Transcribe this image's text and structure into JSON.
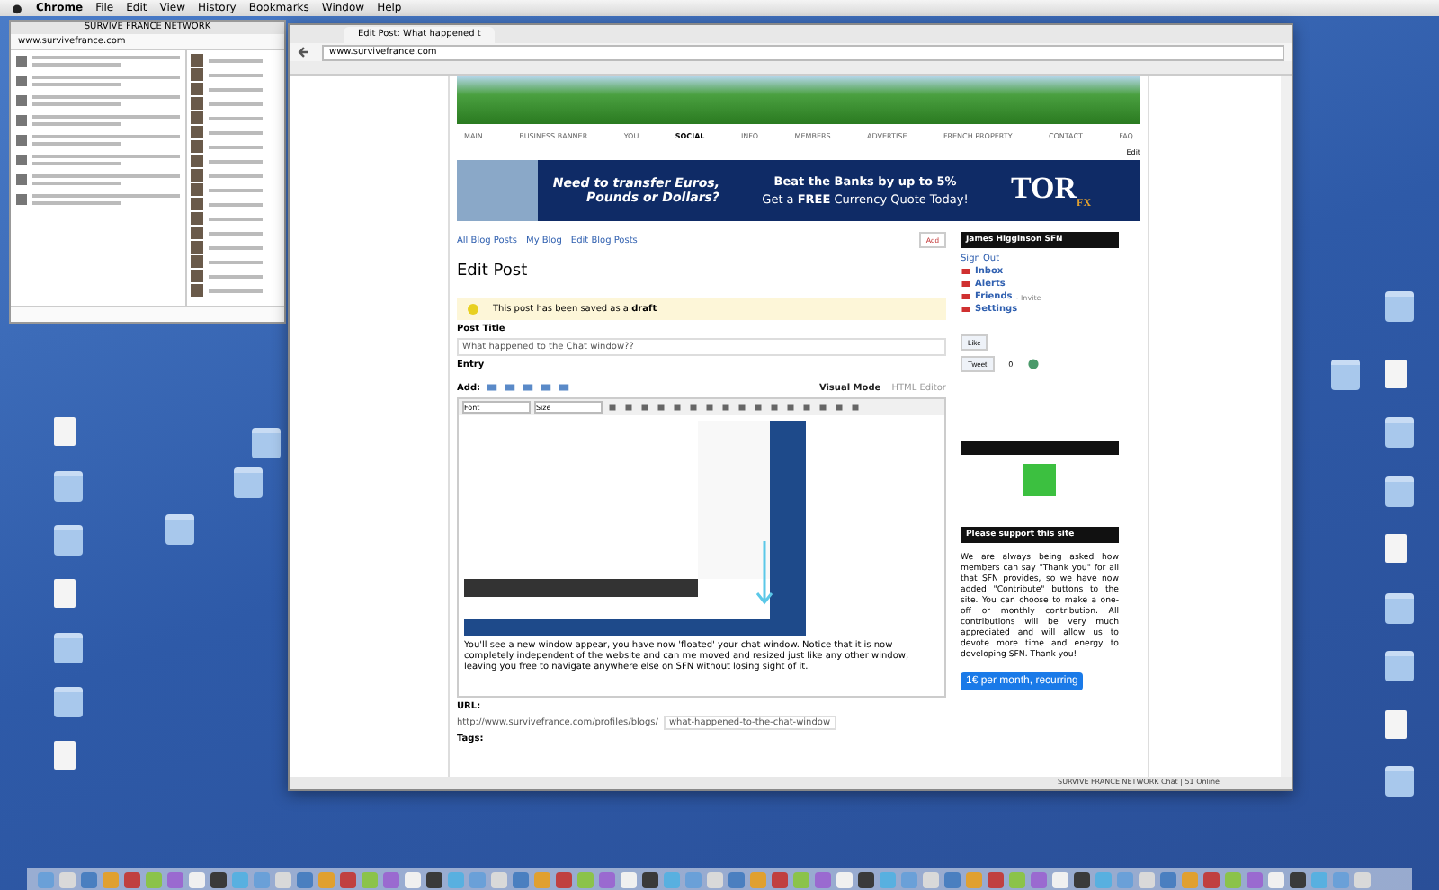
{
  "menubar": {
    "items": [
      "Chrome",
      "File",
      "Edit",
      "View",
      "History",
      "Bookmarks",
      "Window",
      "Help"
    ]
  },
  "chat_window": {
    "title": "SURVIVE FRANCE NETWORK",
    "url": "www.survivefrance.com"
  },
  "browser": {
    "tab_title": "Edit Post: What happened t",
    "url": "www.survivefrance.com",
    "nav": [
      {
        "label": "MAIN",
        "selected": false
      },
      {
        "label": "BUSINESS BANNER",
        "selected": false
      },
      {
        "label": "YOU",
        "selected": false
      },
      {
        "label": "SOCIAL",
        "selected": true
      },
      {
        "label": "INFO",
        "selected": false
      },
      {
        "label": "MEMBERS",
        "selected": false
      },
      {
        "label": "ADVERTISE",
        "selected": false
      },
      {
        "label": "FRENCH PROPERTY",
        "selected": false
      },
      {
        "label": "CONTACT",
        "selected": false
      },
      {
        "label": "FAQ",
        "selected": false
      }
    ],
    "edit_link": "Edit",
    "ad": {
      "left": "Need to transfer Euros, Pounds or Dollars?",
      "right_1": "Beat the Banks by up to 5%",
      "right_2": "Get a **FREE** Currency Quote Today!",
      "logo": "TOR",
      "logo_sub": "FX"
    },
    "blog_links": [
      "All Blog Posts",
      "My Blog",
      "Edit Blog Posts"
    ],
    "add_button": "Add",
    "heading": "Edit Post",
    "notice": "This post has been saved as a **draft**",
    "post_title_label": "Post Title",
    "post_title_value": "What happened to the Chat window??",
    "entry_label": "Entry",
    "add_label": "Add:",
    "editor_modes": [
      {
        "label": "Visual Mode",
        "selected": true
      },
      {
        "label": "HTML Editor",
        "selected": false
      }
    ],
    "font_select": "Font",
    "size_select": "Size",
    "entry_text": "You'll see a new window appear, you have now 'floated' your chat window. Notice that it is now completely independent of the website and can me moved and resized just like any other window, leaving you free to navigate anywhere else on SFN without losing sight of it.",
    "url_label": "URL:",
    "url_prefix": "http://www.survivefrance.com/profiles/blogs/",
    "url_slug": "what-happened-to-the-chat-window",
    "tags_label": "Tags:",
    "sidebar": {
      "user": "James Higginson SFN",
      "sign_out": "Sign Out",
      "items": [
        {
          "label": "Inbox"
        },
        {
          "label": "Alerts"
        },
        {
          "label": "Friends",
          "note": "- Invite"
        },
        {
          "label": "Settings"
        }
      ],
      "like": "Like",
      "tweet": "Tweet",
      "tweet_count": "0",
      "support_title": "Please support this site",
      "support_text": "We are always being asked how members can say \"Thank you\" for all that SFN provides, so we have now added \"Contribute\" buttons to the site. You can choose to make a one-off or monthly contribution. All contributions will be very much appreciated and will allow us to devote more time and energy to developing SFN. Thank you!",
      "contribute": "1€ per month, recurring"
    },
    "status_right": "SURVIVE FRANCE NETWORK Chat | 51 Online"
  }
}
